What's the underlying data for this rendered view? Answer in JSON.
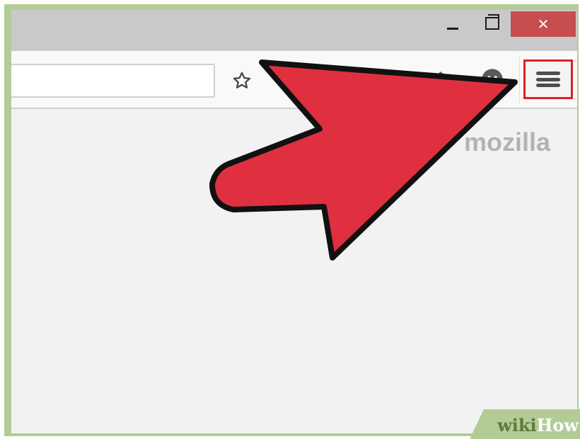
{
  "window": {
    "controls": {
      "minimize_icon": "minimize-icon",
      "maximize_icon": "maximize-icon",
      "close_label": "✕"
    }
  },
  "toolbar": {
    "url": {
      "value": "",
      "placeholder": ""
    },
    "bookmark_icon": "star-icon",
    "home_icon": "home-icon",
    "sync_icon": "sync-icon",
    "menu_icon": "hamburger-menu-icon"
  },
  "content": {
    "brand": "mozilla"
  },
  "annotation": {
    "arrow_color": "#e03040",
    "highlight_color": "#e02020"
  },
  "watermark": {
    "wiki": "wiki",
    "how": "How"
  },
  "colors": {
    "border_green": "#b3cc96",
    "close_red": "#c74e4e"
  }
}
